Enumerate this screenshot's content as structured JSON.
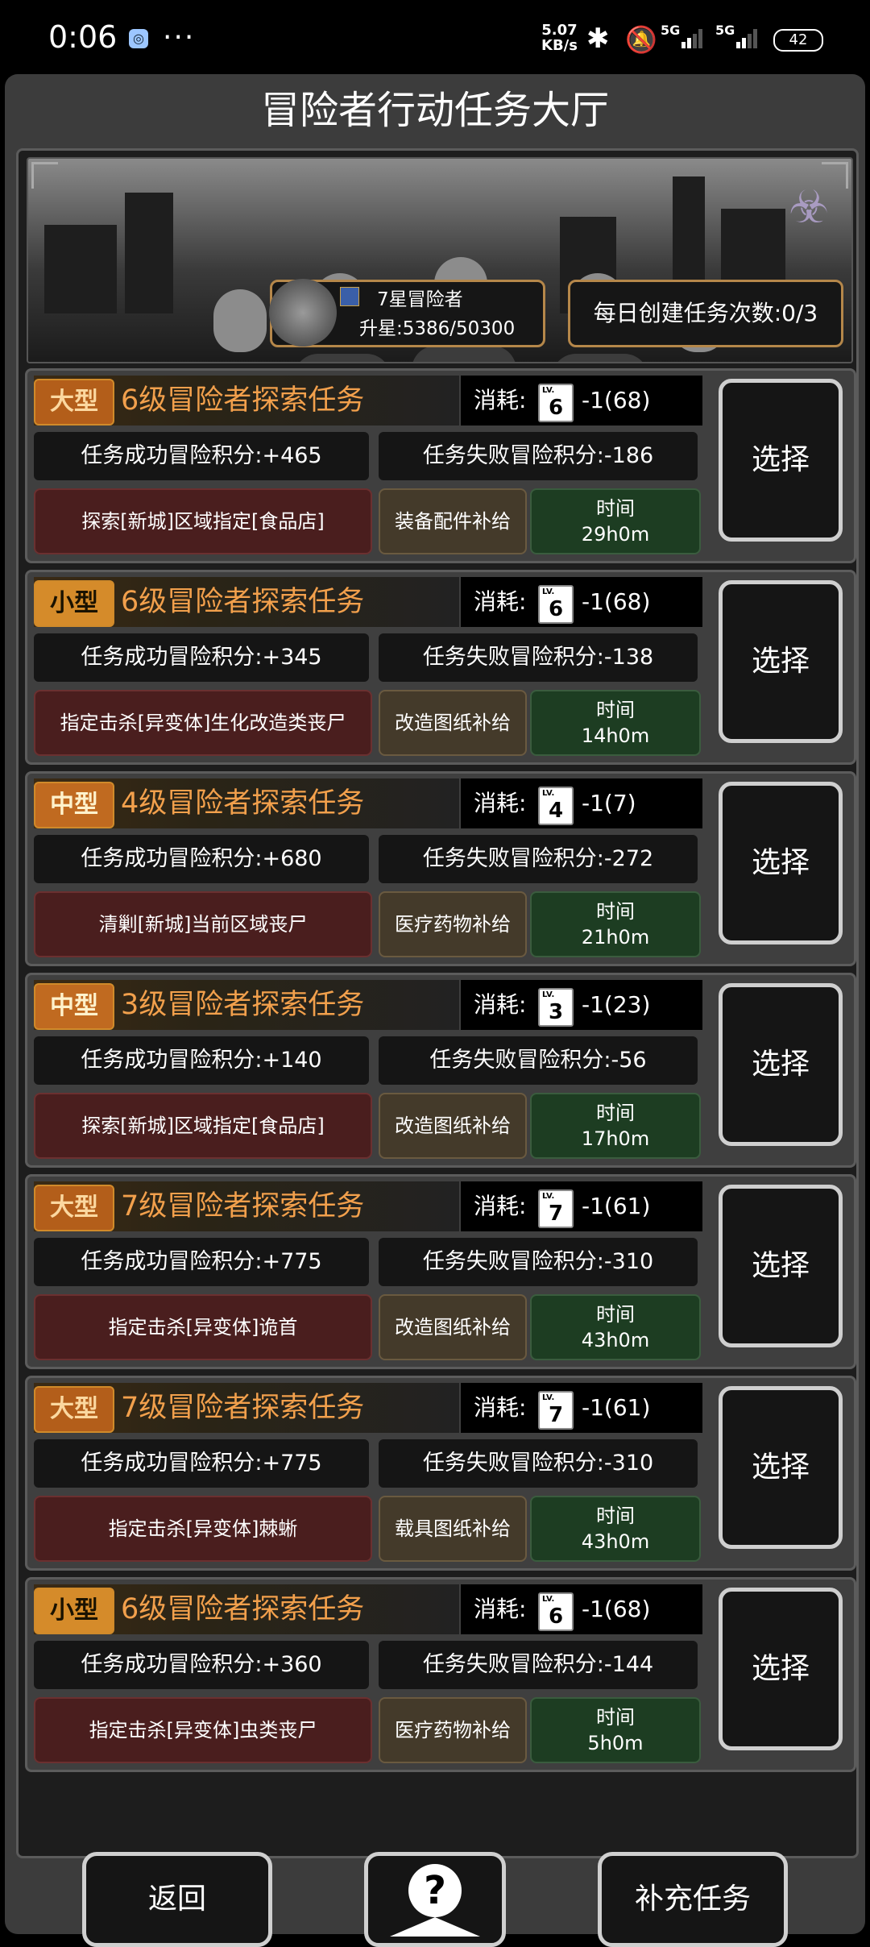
{
  "status_bar": {
    "time": "0:06",
    "more": "···",
    "net_speed_value": "5.07",
    "net_speed_unit": "KB/s",
    "sim1": "5G",
    "sim2": "5G",
    "battery": "42"
  },
  "page": {
    "title": "冒险者行动任务大厅"
  },
  "banner": {
    "rank_name": "7星冒险者",
    "rank_progress": "升星:5386/50300",
    "daily_create": "每日创建任务次数:0/3"
  },
  "cost_label": "消耗:",
  "card_lv_label": "LV.",
  "time_label": "时间",
  "select_label": "选择",
  "tasks": [
    {
      "size": "大型",
      "title": "6级冒险者探索任务",
      "card": "6",
      "cost": "-1(68)",
      "success": "任务成功冒险积分:+465",
      "fail": "任务失败冒险积分:-186",
      "desc": "探索[新城]区域指定[食品店]",
      "supply": "装备配件补给",
      "time": "29h0m"
    },
    {
      "size": "小型",
      "title": "6级冒险者探索任务",
      "card": "6",
      "cost": "-1(68)",
      "success": "任务成功冒险积分:+345",
      "fail": "任务失败冒险积分:-138",
      "desc": "指定击杀[异变体]生化改造类丧尸",
      "supply": "改造图纸补给",
      "time": "14h0m"
    },
    {
      "size": "中型",
      "title": "4级冒险者探索任务",
      "card": "4",
      "cost": "-1(7)",
      "success": "任务成功冒险积分:+680",
      "fail": "任务失败冒险积分:-272",
      "desc": "清剿[新城]当前区域丧尸",
      "supply": "医疗药物补给",
      "time": "21h0m"
    },
    {
      "size": "中型",
      "title": "3级冒险者探索任务",
      "card": "3",
      "cost": "-1(23)",
      "success": "任务成功冒险积分:+140",
      "fail": "任务失败冒险积分:-56",
      "desc": "探索[新城]区域指定[食品店]",
      "supply": "改造图纸补给",
      "time": "17h0m"
    },
    {
      "size": "大型",
      "title": "7级冒险者探索任务",
      "card": "7",
      "cost": "-1(61)",
      "success": "任务成功冒险积分:+775",
      "fail": "任务失败冒险积分:-310",
      "desc": "指定击杀[异变体]诡首",
      "supply": "改造图纸补给",
      "time": "43h0m"
    },
    {
      "size": "大型",
      "title": "7级冒险者探索任务",
      "card": "7",
      "cost": "-1(61)",
      "success": "任务成功冒险积分:+775",
      "fail": "任务失败冒险积分:-310",
      "desc": "指定击杀[异变体]棘蜥",
      "supply": "载具图纸补给",
      "time": "43h0m"
    },
    {
      "size": "小型",
      "title": "6级冒险者探索任务",
      "card": "6",
      "cost": "-1(68)",
      "success": "任务成功冒险积分:+360",
      "fail": "任务失败冒险积分:-144",
      "desc": "指定击杀[异变体]虫类丧尸",
      "supply": "医疗药物补给",
      "time": "5h0m"
    }
  ],
  "bottom": {
    "back": "返回",
    "help_glyph": "?",
    "refill": "补充任务"
  },
  "icons": {
    "app": "app-icon",
    "bluetooth": "bluetooth-icon",
    "mute": "bell-off-icon",
    "signal": "signal-icon",
    "battery": "battery-icon",
    "rank": "rank-badge-icon",
    "logo": "biohazard-logo-icon",
    "help": "help-map-icon"
  },
  "colors": {
    "title_orange": "#f2a04c",
    "size_big": "#b35e1a",
    "size_small": "#d58b2a",
    "desc_red": "#4a1e1e",
    "supply_brown": "#443a2a",
    "time_green": "#1d3d22",
    "gold_border": "#b5874a"
  }
}
